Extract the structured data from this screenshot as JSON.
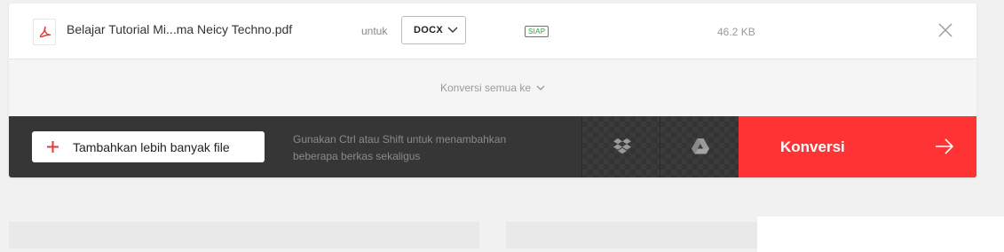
{
  "file": {
    "name": "Belajar Tutorial Mi...ma Neicy Techno.pdf",
    "icon": "pdf-icon",
    "to_label": "untuk",
    "format": "DOCX",
    "status": "SIAP",
    "size": "46.2 KB"
  },
  "convert_all": {
    "label": "Konversi semua ke"
  },
  "action_bar": {
    "add_files_label": "Tambahkan lebih banyak file",
    "hint_line1": "Gunakan Ctrl atau Shift untuk menambahkan",
    "hint_line2": "beberapa berkas sekaligus",
    "convert_label": "Konversi"
  },
  "colors": {
    "accent": "#ff3333",
    "bar": "#363636",
    "status": "#2a9d3a"
  }
}
